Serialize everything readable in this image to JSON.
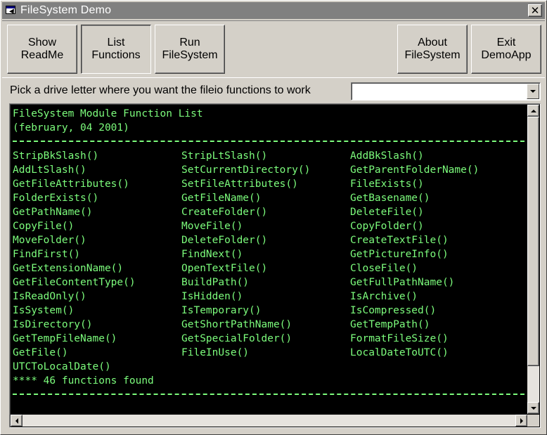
{
  "window": {
    "title": "FileSystem Demo",
    "close_glyph": "✕"
  },
  "toolbar": {
    "show_readme": "Show\nReadMe",
    "list_functions": "List\nFunctions",
    "run_filesystem": "Run\nFileSystem",
    "about_filesystem": "About\nFileSystem",
    "exit_demoapp": "Exit\nDemoApp"
  },
  "drive": {
    "label": "Pick a drive letter where you want the fileio functions to work",
    "selected": ""
  },
  "listing": {
    "title_line": "FileSystem Module Function List",
    "date_line": "(february, 04 2001)",
    "functions": [
      [
        "StripBkSlash()",
        "StripLtSlash()",
        "AddBkSlash()"
      ],
      [
        "AddLtSlash()",
        "SetCurrentDirectory()",
        "GetParentFolderName()"
      ],
      [
        "GetFileAttributes()",
        "SetFileAttributes()",
        "FileExists()"
      ],
      [
        "FolderExists()",
        "GetFileName()",
        "GetBasename()"
      ],
      [
        "GetPathName()",
        "CreateFolder()",
        "DeleteFile()"
      ],
      [
        "CopyFile()",
        "MoveFile()",
        "CopyFolder()"
      ],
      [
        "MoveFolder()",
        "DeleteFolder()",
        "CreateTextFile()"
      ],
      [
        "FindFirst()",
        "FindNext()",
        "GetPictureInfo()"
      ],
      [
        "GetExtensionName()",
        "OpenTextFile()",
        "CloseFile()"
      ],
      [
        "GetFileContentType()",
        "BuildPath()",
        "GetFullPathName()"
      ],
      [
        "IsReadOnly()",
        "IsHidden()",
        "IsArchive()"
      ],
      [
        "IsSystem()",
        "IsTemporary()",
        "IsCompressed()"
      ],
      [
        "IsDirectory()",
        "GetShortPathName()",
        "GetTempPath()"
      ],
      [
        "GetTempFileName()",
        "GetSpecialFolder()",
        "FormatFileSize()"
      ],
      [
        "GetFile()",
        "FileInUse()",
        "LocalDateToUTC()"
      ],
      [
        "UTCToLocalDate()",
        "",
        ""
      ]
    ],
    "summary_line": "**** 46 functions found"
  },
  "colors": {
    "terminal_bg": "#000000",
    "terminal_text": "#7cfc7c",
    "face": "#d4d0c8",
    "titlebar": "#808080"
  },
  "icons": [
    "app-window-icon",
    "close-icon",
    "dropdown-arrow-icon",
    "scroll-up-icon",
    "scroll-down-icon",
    "scroll-left-icon",
    "scroll-right-icon"
  ]
}
